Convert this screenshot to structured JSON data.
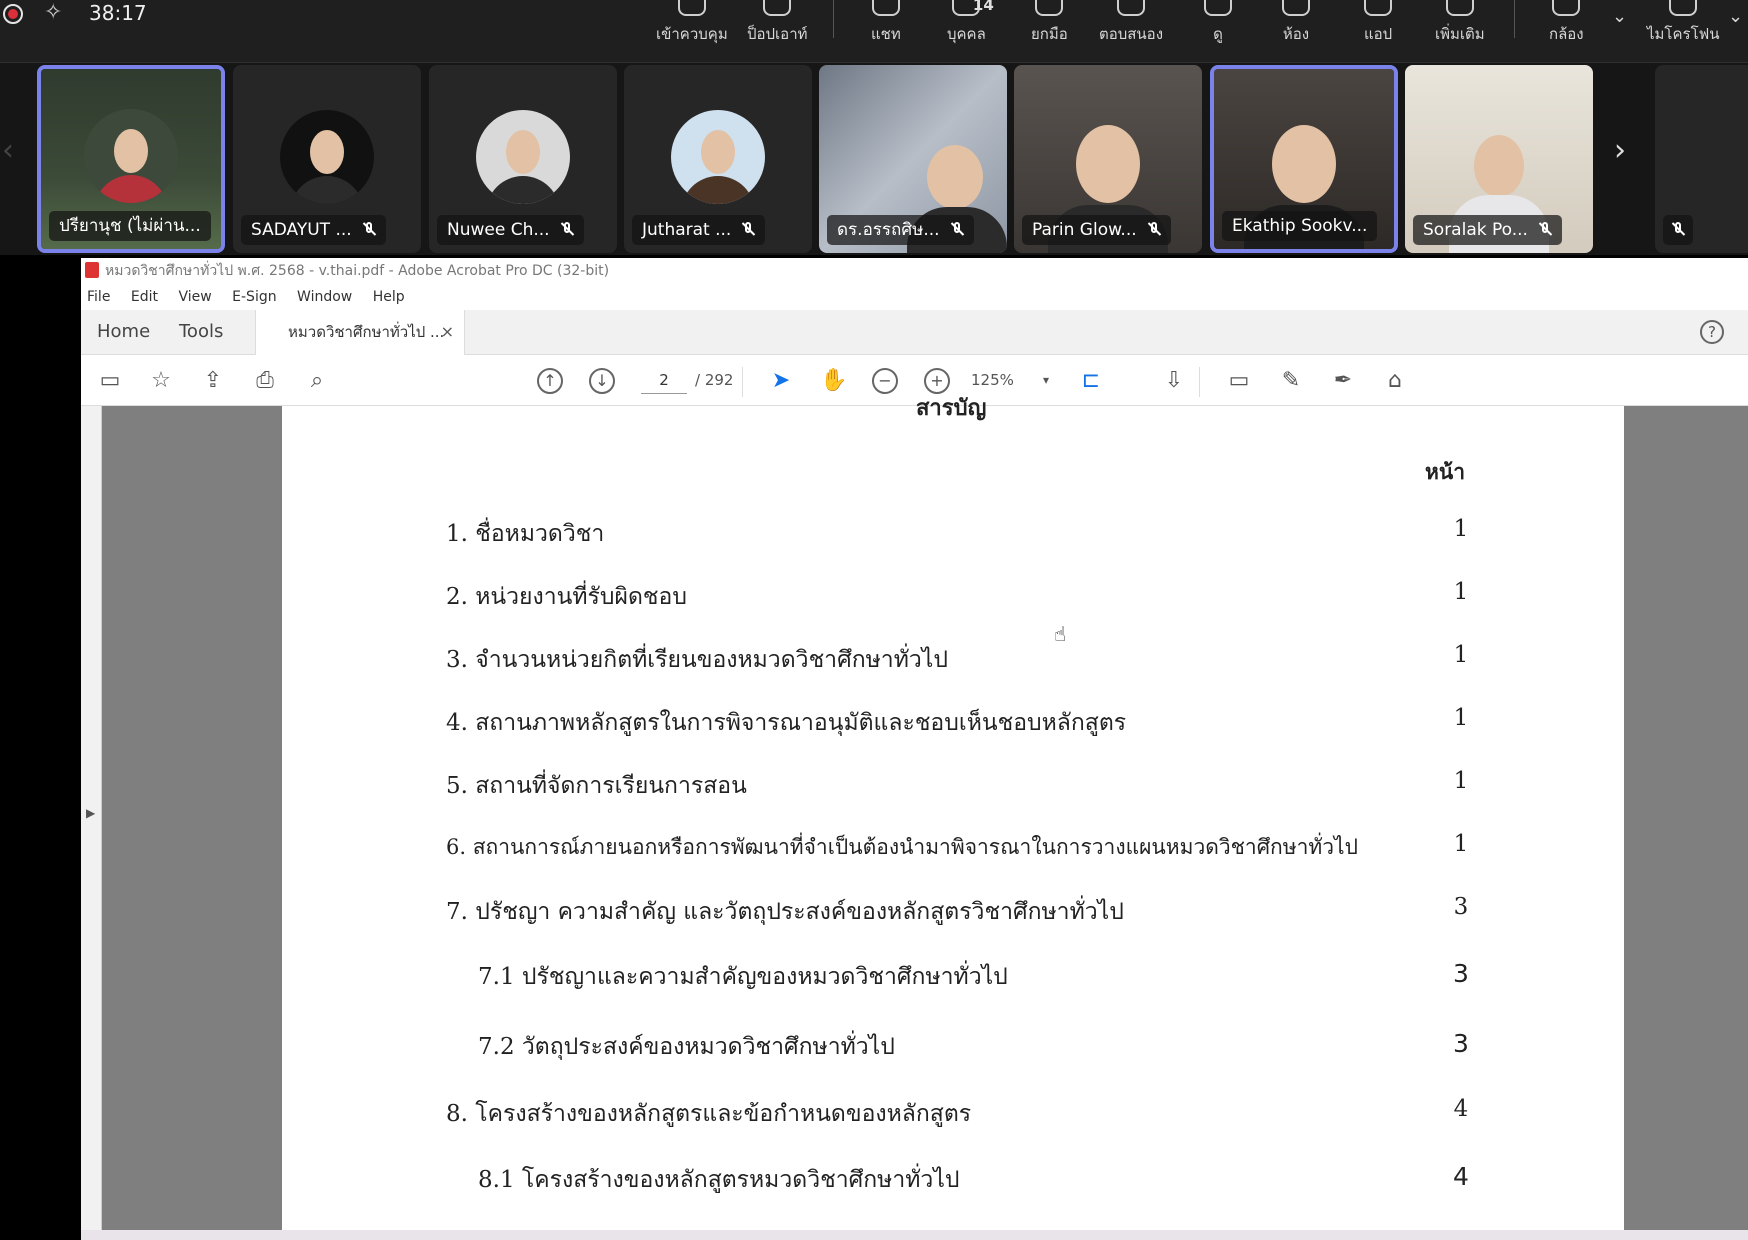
{
  "meeting": {
    "timer": "38:17",
    "toolbar": [
      {
        "label": "เข้าควบคุม",
        "icon": "share-screen-icon"
      },
      {
        "label": "ป็อปเอาท์",
        "icon": "popout-icon"
      },
      {
        "label": "แชท",
        "icon": "chat-icon"
      },
      {
        "label": "บุคคล",
        "icon": "people-icon",
        "count": "14"
      },
      {
        "label": "ยกมือ",
        "icon": "raise-hand-icon"
      },
      {
        "label": "ตอบสนอง",
        "icon": "react-icon"
      },
      {
        "label": "ดู",
        "icon": "view-icon"
      },
      {
        "label": "ห้อง",
        "icon": "rooms-icon"
      },
      {
        "label": "แอป",
        "icon": "apps-icon"
      },
      {
        "label": "เพิ่มเติม",
        "icon": "more-icon"
      },
      {
        "label": "กล้อง",
        "icon": "camera-off-icon"
      },
      {
        "label": "ไมโครโฟน",
        "icon": "mic-off-icon"
      }
    ],
    "participants": [
      {
        "name": "ปรียานุช (ไม่ผ่าน...",
        "active": true
      },
      {
        "name": "SADAYUT ...",
        "active": false
      },
      {
        "name": "Nuwee Ch...",
        "active": false
      },
      {
        "name": "Jutharat ...",
        "active": false
      },
      {
        "name": "ดร.อรรถศิษ...",
        "active": false
      },
      {
        "name": "Parin Glow...",
        "active": false
      },
      {
        "name": "Ekathip Sookv...",
        "active": true
      },
      {
        "name": "Soralak Po...",
        "active": false
      }
    ]
  },
  "acrobat": {
    "window_title": "หมวดวิชาศึกษาทั่วไป พ.ศ. 2568 - v.thai.pdf - Adobe Acrobat Pro DC (32-bit)",
    "menu": [
      "File",
      "Edit",
      "View",
      "E-Sign",
      "Window",
      "Help"
    ],
    "nav_tabs": [
      "Home",
      "Tools"
    ],
    "doc_tab": "หมวดวิชาศึกษาทั่วไป ...",
    "page_current": "2",
    "page_total": "/ 292",
    "zoom": "125%"
  },
  "document": {
    "heading_cut": "สารบัญ",
    "page_col_header": "หน้า",
    "toc": [
      {
        "text": "1. ชื่อหมวดวิชา",
        "page": "1",
        "sub": false
      },
      {
        "text": "2. หน่วยงานที่รับผิดชอบ",
        "page": "1",
        "sub": false
      },
      {
        "text": "3. จำนวนหน่วยกิตที่เรียนของหมวดวิชาศึกษาทั่วไป",
        "page": "1",
        "sub": false
      },
      {
        "text": "4. สถานภาพหลักสูตรในการพิจารณาอนุมัติและชอบเห็นชอบหลักสูตร",
        "page": "1",
        "sub": false
      },
      {
        "text": "5. สถานที่จัดการเรียนการสอน",
        "page": "1",
        "sub": false
      },
      {
        "text": "6. สถานการณ์ภายนอกหรือการพัฒนาที่จำเป็นต้องนำมาพิจารณาในการวางแผนหมวดวิชาศึกษาทั่วไป",
        "page": "1",
        "sub": false
      },
      {
        "text": "7. ปรัชญา ความสำคัญ และวัตถุประสงค์ของหลักสูตรวิชาศึกษาทั่วไป",
        "page": "3",
        "sub": false
      },
      {
        "text": "7.1 ปรัชญาและความสำคัญของหมวดวิชาศึกษาทั่วไป",
        "page": "3",
        "sub": true
      },
      {
        "text": "7.2 วัตถุประสงค์ของหมวดวิชาศึกษาทั่วไป",
        "page": "3",
        "sub": true
      },
      {
        "text": "8. โครงสร้างของหลักสูตรและข้อกำหนดของหลักสูตร",
        "page": "4",
        "sub": false
      },
      {
        "text": "8.1 โครงสร้างของหลักสูตรหมวดวิชาศึกษาทั่วไป",
        "page": "4",
        "sub": true
      }
    ]
  },
  "colors": {
    "active_tile_border": "#7b83eb",
    "record": "#d9303a",
    "meeting_bg": "#1f1f1f"
  }
}
